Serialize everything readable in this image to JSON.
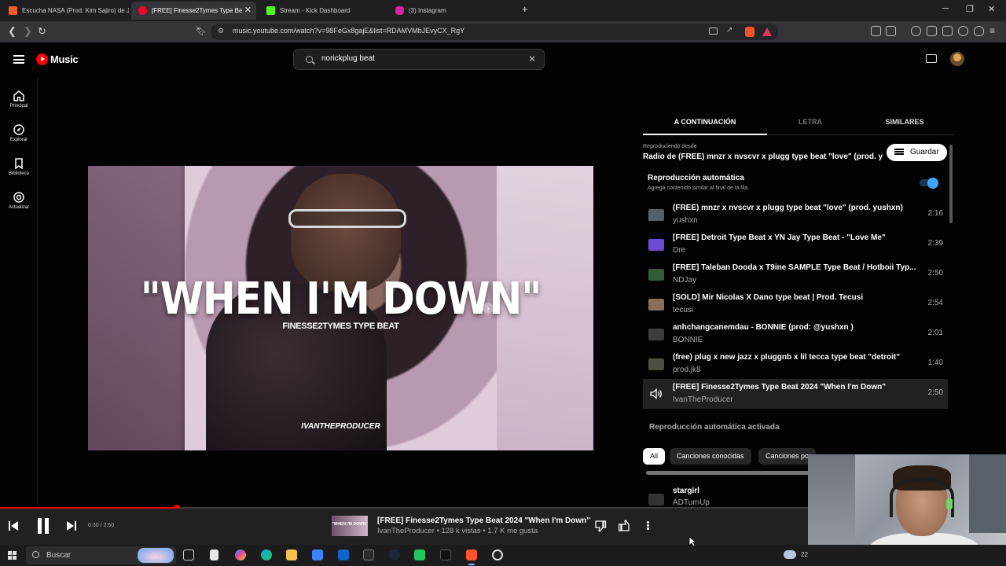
{
  "browser": {
    "tabs": [
      {
        "title": "Escucha NASA (Prod. Kim Sajiro) de J",
        "color": "#f45b2a",
        "active": false
      },
      {
        "title": "[FREE] Finesse2Tymes Type Be",
        "color": "#ff0033",
        "active": true
      },
      {
        "title": "Stream - Kick Dashboard",
        "color": "#53fc18",
        "active": false
      },
      {
        "title": "(3) Instagram",
        "color": "#d6249f",
        "active": false
      }
    ],
    "new_tab": "+",
    "url": "music.youtube.com/watch?v=98FeGx8gajE&list=RDAMVMbJEvyCX_RgY"
  },
  "header": {
    "logo_text": "Music",
    "search_value": "norickplug beat",
    "search_clear": "✕"
  },
  "leftnav": {
    "items": [
      {
        "label": "Principal",
        "icon": "home-icon"
      },
      {
        "label": "Explorar",
        "icon": "compass-icon"
      },
      {
        "label": "Biblioteca",
        "icon": "library-icon"
      },
      {
        "label": "Actualizar",
        "icon": "upgrade-icon"
      }
    ]
  },
  "video": {
    "title": "\"WHEN I'M DOWN\"",
    "subtitle": "FINESSE2TYMES TYPE BEAT",
    "watermark": "IVANTHEPRODUCER"
  },
  "panel": {
    "tabs": [
      "A CONTINUACIÓN",
      "LETRA",
      "SIMILARES"
    ],
    "playing_from_label": "Reproduciendo desde",
    "playing_from": "Radio de (FREE) mnzr x nvscvr x plugg type beat \"love\" (prod. y...",
    "save_label": "Guardar",
    "autoplay_title": "Reproducción automática",
    "autoplay_desc": "Agrega contenido similar al final de la fila.",
    "autoplay_enabled": true,
    "queue": [
      {
        "title": "(FREE) mnzr x nvscvr x plugg type beat \"love\" (prod. yushxn)",
        "artist": "yushxn",
        "duration": "2:16",
        "thumb": "#55606a"
      },
      {
        "title": "[FREE] Detroit Type Beat x YN Jay Type Beat - \"Love Me\"",
        "artist": "Dre",
        "duration": "2:39",
        "thumb": "#6a4bd1"
      },
      {
        "title": "[FREE] Taleban Dooda x T9ine SAMPLE Type Beat / Hotboii Typ...",
        "artist": "NDJay",
        "duration": "2:50",
        "thumb": "#2f5d3a"
      },
      {
        "title": "[SOLD] Mir Nicolas X Dano type beat | Prod. Tecusi",
        "artist": "tecusi",
        "duration": "2:54",
        "thumb": "#8a6d5a"
      },
      {
        "title": "anhchangcanemdau - BONNIE (prod: @yushxn )",
        "artist": "BONNIE",
        "duration": "2:01",
        "thumb": "#3c3c3c"
      },
      {
        "title": "(free) plug x new jazz x pluggnb x lil tecca type beat \"detroit\"",
        "artist": "prod.jk8",
        "duration": "1:40",
        "thumb": "#4d4f44"
      },
      {
        "title": "[FREE] Finesse2Tymes Type Beat 2024 \"When I'm Down\"",
        "artist": "IvanTheProducer",
        "duration": "2:50",
        "thumb": "#212121",
        "current": true
      }
    ],
    "autoplay_on_label": "Reproducción automática activada",
    "chips": [
      "All",
      "Canciones conocidas",
      "Canciones po"
    ],
    "next_title": "stargirl",
    "next_artist": "ADTurnUp"
  },
  "player": {
    "time": "0:30 / 2:50",
    "progress": 0.176,
    "title": "[FREE] Finesse2Tymes Type Beat 2024 \"When I'm Down\"",
    "meta": "IvanTheProducer • 128 k vistas • 1.7 K me gusta",
    "thumb_text": "\"WHEN I'M DOWN\""
  },
  "taskbar": {
    "search_label": "Buscar",
    "temp": "22",
    "icons": [
      "task-view-icon",
      "notepad-icon",
      "copilot-icon",
      "edge-icon",
      "file-explorer-icon",
      "store-icon",
      "outlook-icon",
      "terminal-icon",
      "steam-icon",
      "green-app-icon",
      "tiktok-icon",
      "brave-icon",
      "obs-icon"
    ]
  },
  "colors": {
    "accent": "#ff0000",
    "toggle": "#3ea6ff",
    "background": "#030303"
  }
}
